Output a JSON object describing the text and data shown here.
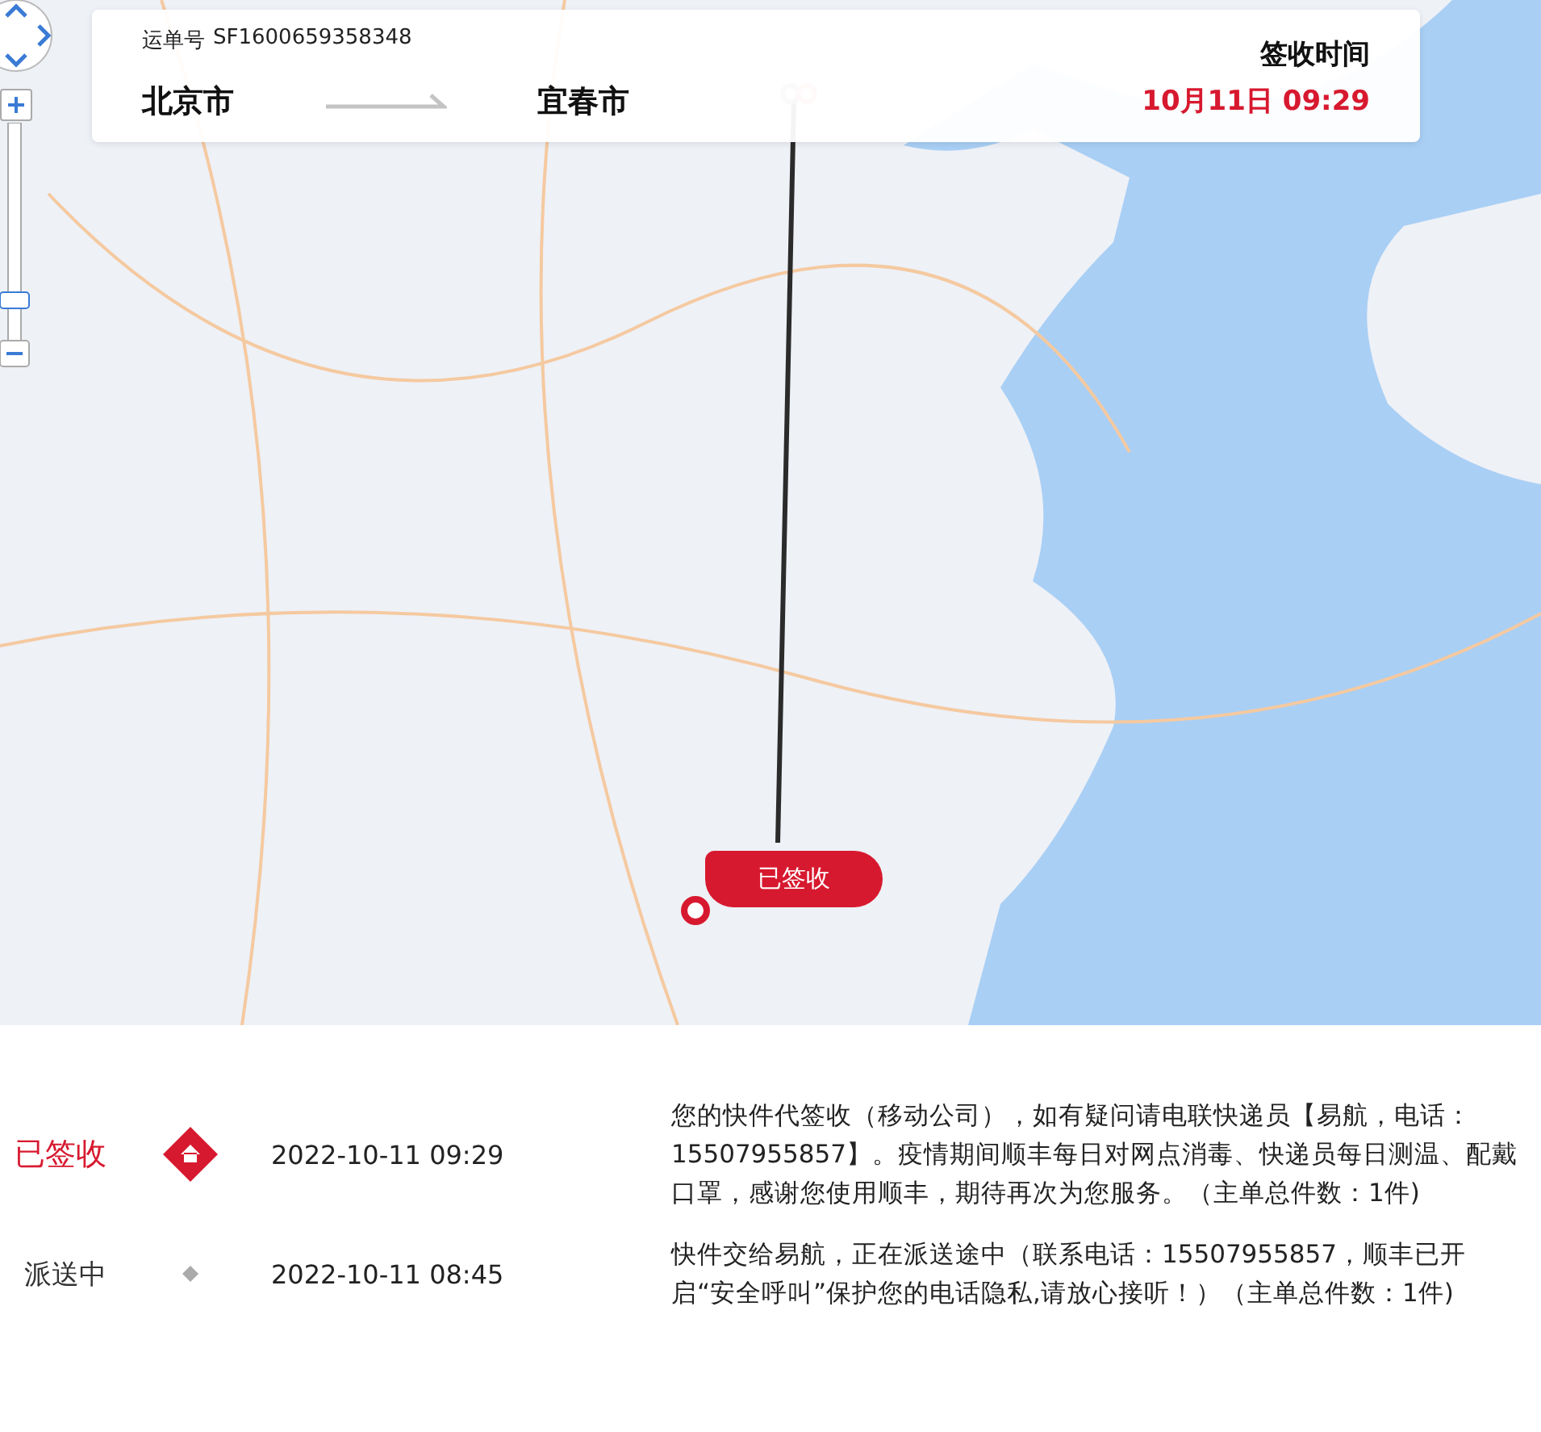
{
  "header": {
    "waybill_label": "运单号",
    "waybill_number": "SF1600659358348",
    "origin": "北京市",
    "destination": "宜春市",
    "time_label": "签收时间",
    "time_value": "10月11日 09:29"
  },
  "map": {
    "badge": "已签收"
  },
  "timeline": [
    {
      "status": "已签收",
      "current": true,
      "time": "2022-10-11 09:29",
      "description": "您的快件代签收（移动公司），如有疑问请电联快递员【易航，电话：15507955857】。疫情期间顺丰每日对网点消毒、快递员每日测温、配戴口罩，感谢您使用顺丰，期待再次为您服务。（主单总件数：1件)"
    },
    {
      "status": "派送中",
      "current": false,
      "time": "2022-10-11 08:45",
      "description": "快件交给易航，正在派送途中（联系电话：15507955857，顺丰已开启“安全呼叫”保护您的电话隐私,请放心接听！）（主单总件数：1件)"
    }
  ]
}
